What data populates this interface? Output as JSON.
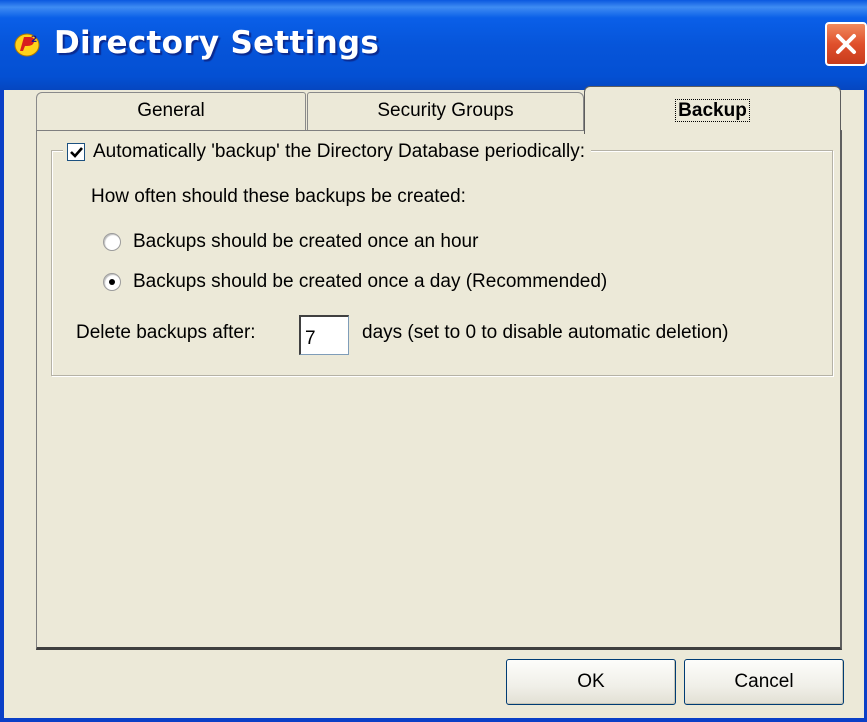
{
  "window": {
    "title": "Directory Settings",
    "app_icon": "p2-app-icon",
    "close_icon": "close-icon",
    "close_color": "#e0502c",
    "titlebar_color": "#0655da"
  },
  "tabs": [
    {
      "label": "General",
      "active": false
    },
    {
      "label": "Security Groups",
      "active": false
    },
    {
      "label": "Backup",
      "active": true
    }
  ],
  "backup": {
    "auto_backup": {
      "label": "Automatically 'backup' the Directory Database periodically:",
      "checked": true
    },
    "frequency_prompt": "How often should these backups be created:",
    "options": [
      {
        "label": "Backups should be created once an hour",
        "selected": false
      },
      {
        "label": "Backups should be created once a day (Recommended)",
        "selected": true
      }
    ],
    "delete_label": "Delete backups after:",
    "delete_days": "7",
    "delete_hint": "days (set to 0 to disable automatic deletion)"
  },
  "buttons": {
    "ok": "OK",
    "cancel": "Cancel"
  }
}
